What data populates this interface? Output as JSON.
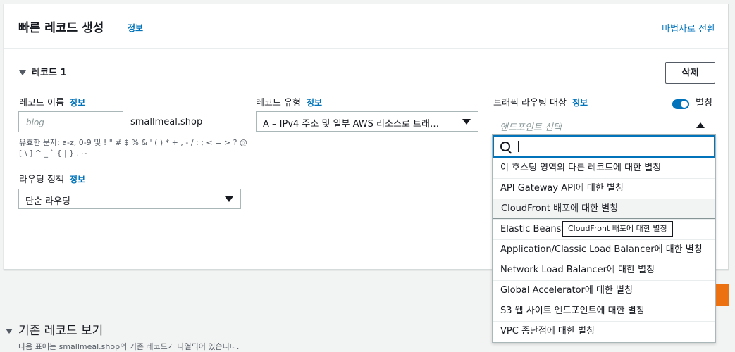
{
  "header": {
    "title": "빠른 레코드 생성",
    "info": "정보",
    "wizard_link": "마법사로 전환"
  },
  "record": {
    "title": "레코드 1",
    "delete_label": "삭제"
  },
  "record_name": {
    "label": "레코드 이름",
    "info": "정보",
    "placeholder": "blog",
    "suffix": "smallmeal.shop",
    "hint_line1": "유효한 문자: a-z, 0-9 및 ! \" # $ % & ' ( ) * + , - / : ; < = > ? @",
    "hint_line2": "[ \\ ] ^ _ ` { | } . ~"
  },
  "record_type": {
    "label": "레코드 유형",
    "info": "정보",
    "value": "A – IPv4 주소 및 일부 AWS 리소스로 트래…"
  },
  "routing_policy": {
    "label": "라우팅 정책",
    "info": "정보",
    "value": "단순 라우팅"
  },
  "traffic_target": {
    "label": "트래픽 라우팅 대상",
    "info": "정보",
    "alias_label": "별칭",
    "placeholder": "엔드포인트 선택"
  },
  "dropdown": {
    "options": [
      "이 호스팅 영역의 다른 레코드에 대한 별칭",
      "API Gateway API에 대한 별칭",
      "CloudFront 배포에 대한 별칭",
      "Elastic Beanstalk 환경에 대한 별칭",
      "Application/Classic Load Balancer에 대한 별칭",
      "Network Load Balancer에 대한 별칭",
      "Global Accelerator에 대한 별칭",
      "S3 웹 사이트 엔드포인트에 대한 별칭",
      "VPC 종단점에 대한 별칭"
    ],
    "tooltip": "CloudFront 배포에 대한 별칭"
  },
  "existing": {
    "title": "기존 레코드 보기",
    "description": "다음 표에는 smallmeal.shop의 기존 레코드가 나열되어 있습니다."
  },
  "colors": {
    "accent": "#0073bb",
    "primary_button": "#ec7211"
  }
}
